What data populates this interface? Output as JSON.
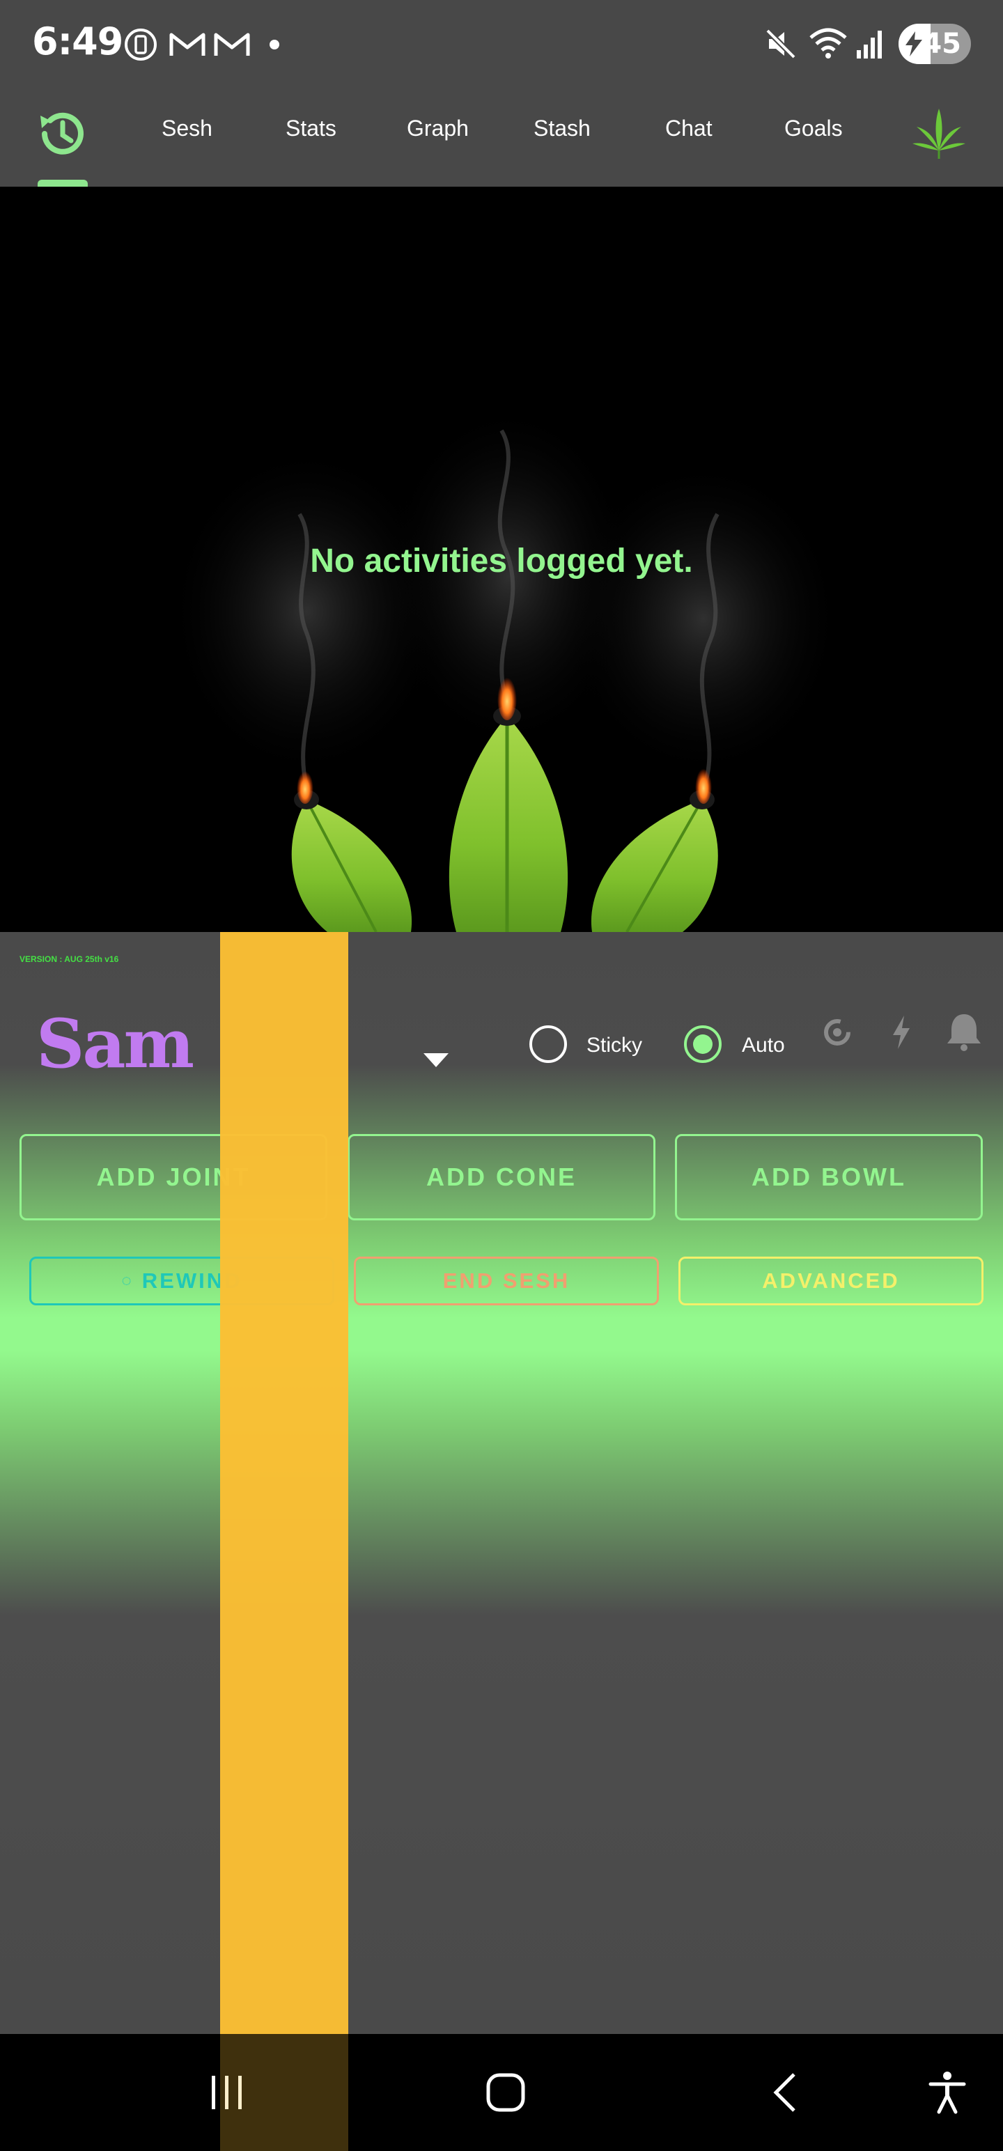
{
  "status_bar": {
    "time": "6:49",
    "battery_level": "45",
    "icons": [
      "screen-record-icon",
      "gmail-icon",
      "gmail-icon",
      "notification-dot-icon",
      "mute-icon",
      "wifi-icon",
      "signal-icon",
      "battery-charging-icon"
    ]
  },
  "tabs": {
    "history_icon": "history-icon",
    "items": [
      {
        "label": "Sesh"
      },
      {
        "label": "Stats"
      },
      {
        "label": "Graph"
      },
      {
        "label": "Stash"
      },
      {
        "label": "Chat"
      },
      {
        "label": "Goals"
      }
    ],
    "logo_icon": "cannabis-leaf-icon",
    "active": "history"
  },
  "hero": {
    "empty_message": "No activities logged yet."
  },
  "panel": {
    "version": "VERSION : AUG 25th v16",
    "user_name": "Sam",
    "options": {
      "sticky_label": "Sticky",
      "sticky_checked": false,
      "auto_label": "Auto",
      "auto_checked": true
    },
    "icons": [
      "rotate-icon",
      "lightning-icon",
      "bell-icon"
    ],
    "buttons": {
      "add_joint": "ADD JOINT",
      "add_cone": "ADD CONE",
      "add_bowl": "ADD BOWL",
      "rewind": "REWIND",
      "end_sesh": "END SESH",
      "advanced": "ADVANCED"
    }
  },
  "colors": {
    "accent": "#93f58f",
    "user_name": "#c17bf0",
    "rewind": "#1fc8b8",
    "end_sesh": "#f0a070",
    "advanced": "#f4f06a",
    "overlay_strip": "#fbbf34"
  },
  "nav_bar": {
    "icons": [
      "recent-apps-icon",
      "home-icon",
      "back-icon",
      "accessibility-icon"
    ]
  }
}
